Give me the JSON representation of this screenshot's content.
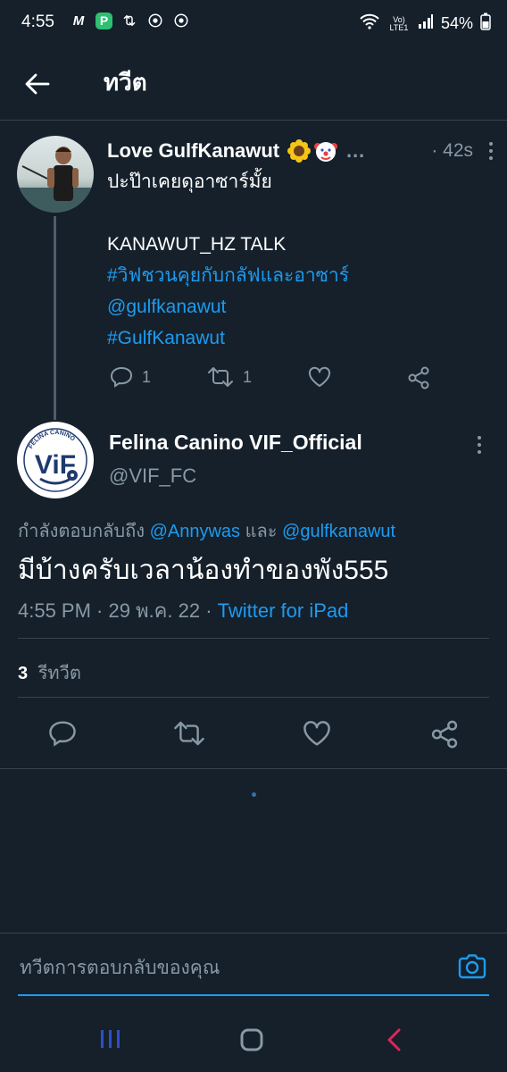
{
  "status_bar": {
    "time": "4:55",
    "battery": "54%",
    "network": "Vo) LTE1"
  },
  "header": {
    "title": "ทวีต"
  },
  "parent_tweet": {
    "name": "Love GulfKanawut",
    "emojis": "🌻🤡",
    "ellipsis": "…",
    "time": "· 42s",
    "text_line1": "ปะป๊าเคยดุอาซาร์มั้ย",
    "text_line2": "KANAWUT_HZ TALK",
    "hashtag1": "#วิฟชวนคุยกับกลัฟและอาซาร์",
    "mention": "@gulfkanawut",
    "hashtag2": "#GulfKanawut",
    "reply_count": "1",
    "retweet_count": "1"
  },
  "main_tweet": {
    "name": "Felina Canino VIF_Official",
    "handle": "@VIF_FC",
    "avatar_logo_text": "ViF",
    "avatar_ring_text": "FELINA CANINO",
    "replying_prefix": "กำลังตอบกลับถึง",
    "replying_user1": "@Annywas",
    "replying_and": "และ",
    "replying_user2": "@gulfkanawut",
    "text": "มีบ้างครับเวลาน้องทำของพัง555",
    "timestamp": "4:55 PM · 29 พ.ค. 22 ·",
    "source": "Twitter for iPad",
    "retweet_count": "3",
    "retweet_label": "รีทวีต"
  },
  "reply_box": {
    "placeholder": "ทวีตการตอบกลับของคุณ"
  },
  "colors": {
    "background": "#15202b",
    "accent": "#1d9bf0",
    "muted": "#8899a6",
    "nav_back": "#e0245e",
    "nav_recent": "#2b50c8"
  }
}
